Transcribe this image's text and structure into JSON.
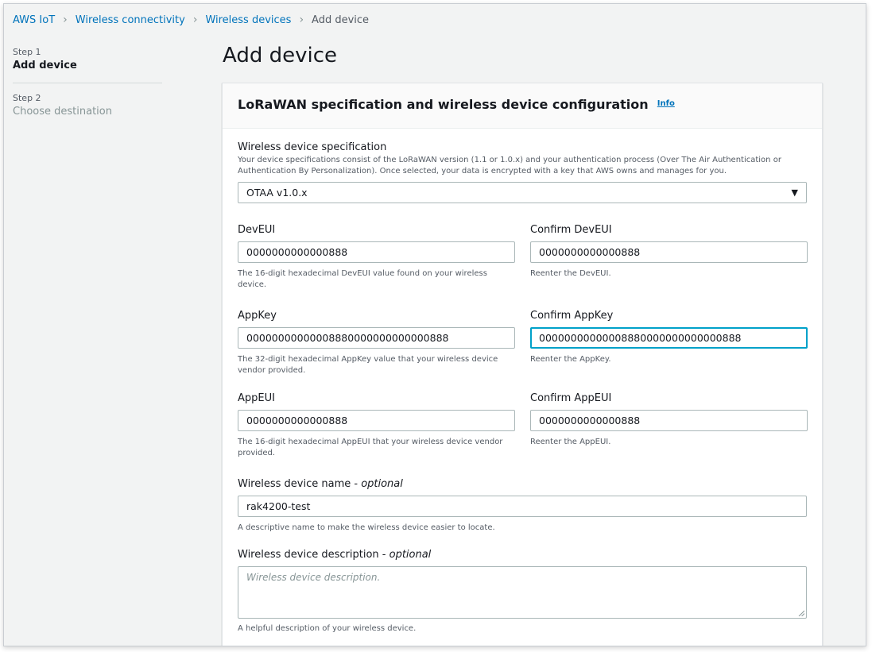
{
  "breadcrumb": {
    "items": [
      "AWS IoT",
      "Wireless connectivity",
      "Wireless devices"
    ],
    "current": "Add device"
  },
  "steps": [
    {
      "num": "Step 1",
      "title": "Add device"
    },
    {
      "num": "Step 2",
      "title": "Choose destination"
    }
  ],
  "page_title": "Add device",
  "panel": {
    "title": "LoRaWAN specification and wireless device configuration",
    "info": "Info"
  },
  "spec": {
    "label": "Wireless device specification",
    "description": "Your device specifications consist of the LoRaWAN version (1.1 or 1.0.x) and your authentication process (Over The Air Authentication or Authentication By Personalization). Once selected, your data is encrypted with a key that AWS owns and manages for you.",
    "value": "OTAA v1.0.x"
  },
  "deveui": {
    "label": "DevEUI",
    "value": "0000000000000888",
    "description": "The 16-digit hexadecimal DevEUI value found on your wireless device.",
    "confirm_label": "Confirm DevEUI",
    "confirm_value": "0000000000000888",
    "confirm_description": "Reenter the DevEUI."
  },
  "appkey": {
    "label": "AppKey",
    "value": "00000000000008880000000000000888",
    "description": "The 32-digit hexadecimal AppKey value that your wireless device vendor provided.",
    "confirm_label": "Confirm AppKey",
    "confirm_value": "00000000000008880000000000000888",
    "confirm_description": "Reenter the AppKey."
  },
  "appeui": {
    "label": "AppEUI",
    "value": "0000000000000888",
    "description": "The 16-digit hexadecimal AppEUI that your wireless device vendor provided.",
    "confirm_label": "Confirm AppEUI",
    "confirm_value": "0000000000000888",
    "confirm_description": "Reenter the AppEUI."
  },
  "name": {
    "label": "Wireless device name - ",
    "optional": "optional",
    "value": "rak4200-test",
    "description": "A descriptive name to make the wireless device easier to locate."
  },
  "description_field": {
    "label": "Wireless device description - ",
    "optional": "optional",
    "placeholder": "Wireless device description.",
    "description": "A helpful description of your wireless device."
  },
  "icons": {
    "breadcrumb_separator": "chevron-right-icon",
    "select_arrow": "caret-down-icon",
    "resize": "resize-grip-icon"
  },
  "colors": {
    "link": "#0073bb",
    "focus": "#00a1c9",
    "text": "#16191f",
    "muted": "#545b64",
    "background": "#f2f3f3"
  }
}
